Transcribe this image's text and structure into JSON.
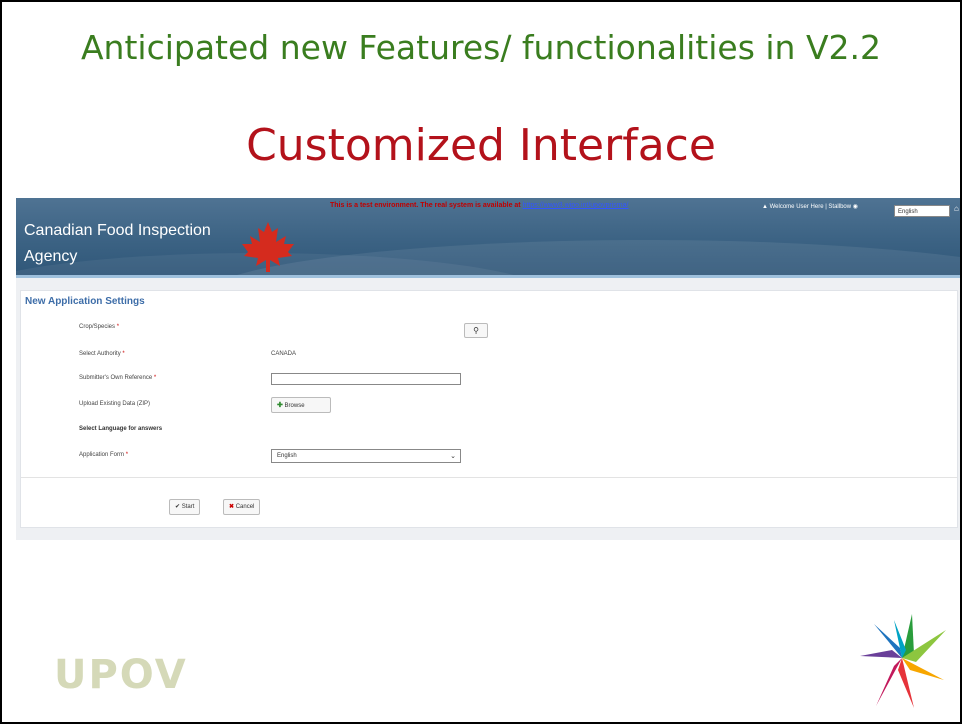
{
  "slide": {
    "title": "Anticipated new Features/ functionalities in V2.2",
    "subtitle": "Customized Interface",
    "logo_text": "UPOV"
  },
  "app": {
    "agency_line1": "Canadian Food Inspection",
    "agency_line2": "Agency",
    "test_message": "This is a test environment. The real system is available at",
    "test_link": "https://www3.wipo.int/upovprisma/",
    "user_text": "Welcome User Here | Stallbow",
    "language": "English",
    "form": {
      "heading": "New Application Settings",
      "crop_label": "Crop/Species",
      "authority_label": "Select Authority",
      "authority_value": "CANADA",
      "reference_label": "Submitter's Own Reference",
      "upload_label": "Upload Existing Data (ZIP)",
      "browse_label": "Browse",
      "section_label": "Select Language for answers",
      "appform_label": "Application Form",
      "appform_value": "English",
      "start_label": "Start",
      "cancel_label": "Cancel",
      "required_mark": "*"
    }
  },
  "colors": {
    "title_green": "#3a7d1f",
    "subtitle_red": "#b3121b",
    "banner_blue": "#3b6283",
    "heading_blue": "#3d6da8"
  }
}
